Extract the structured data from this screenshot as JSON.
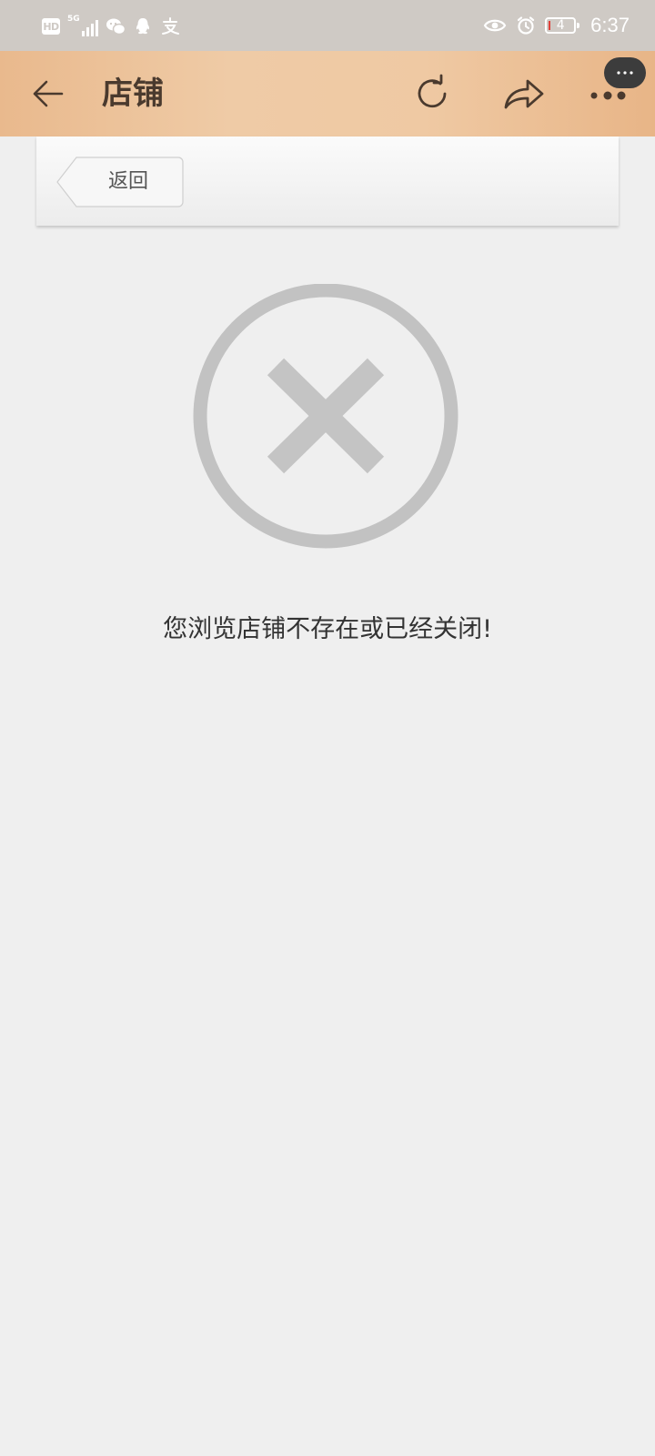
{
  "status_bar": {
    "hd_badge": "HD",
    "network_tag": "5G",
    "battery_level": "4",
    "time": "6:37",
    "icons": [
      "wechat-icon",
      "qq-icon",
      "alipay-icon",
      "eye-icon",
      "alarm-icon"
    ]
  },
  "header": {
    "title": "店铺",
    "background_color": "#efc9a3",
    "icons": [
      "back-arrow-icon",
      "refresh-icon",
      "share-icon",
      "more-icon"
    ]
  },
  "back_panel": {
    "back_label": "返回"
  },
  "error": {
    "icon": "close-circle-icon",
    "message": "您浏览店铺不存在或已经关闭!"
  }
}
